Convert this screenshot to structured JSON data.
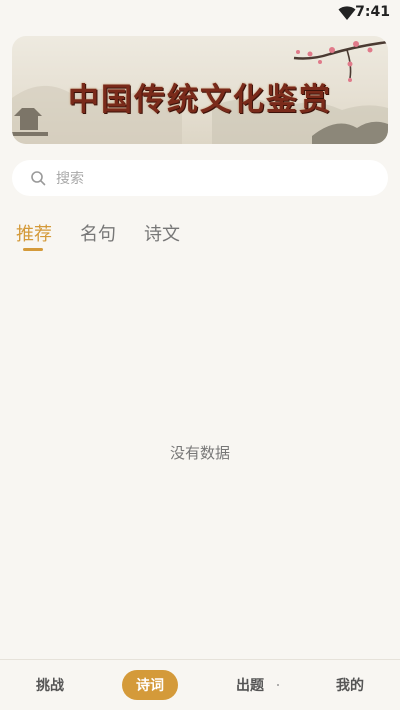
{
  "status_bar": {
    "time": "7:41",
    "icons": [
      "wifi-icon"
    ]
  },
  "banner": {
    "title": "中国传统文化鉴赏",
    "accent": "#7a2a1a"
  },
  "search": {
    "placeholder": "搜索",
    "value": ""
  },
  "tabs": [
    {
      "label": "推荐",
      "active": true
    },
    {
      "label": "名句",
      "active": false
    },
    {
      "label": "诗文",
      "active": false
    }
  ],
  "content": {
    "empty_text": "没有数据"
  },
  "bottom_nav": [
    {
      "label": "挑战",
      "active": false
    },
    {
      "label": "诗词",
      "active": true
    },
    {
      "label": "出题",
      "active": false
    },
    {
      "label": "我的",
      "active": false
    }
  ],
  "colors": {
    "accent": "#d49a3a",
    "background": "#f8f6f2"
  }
}
